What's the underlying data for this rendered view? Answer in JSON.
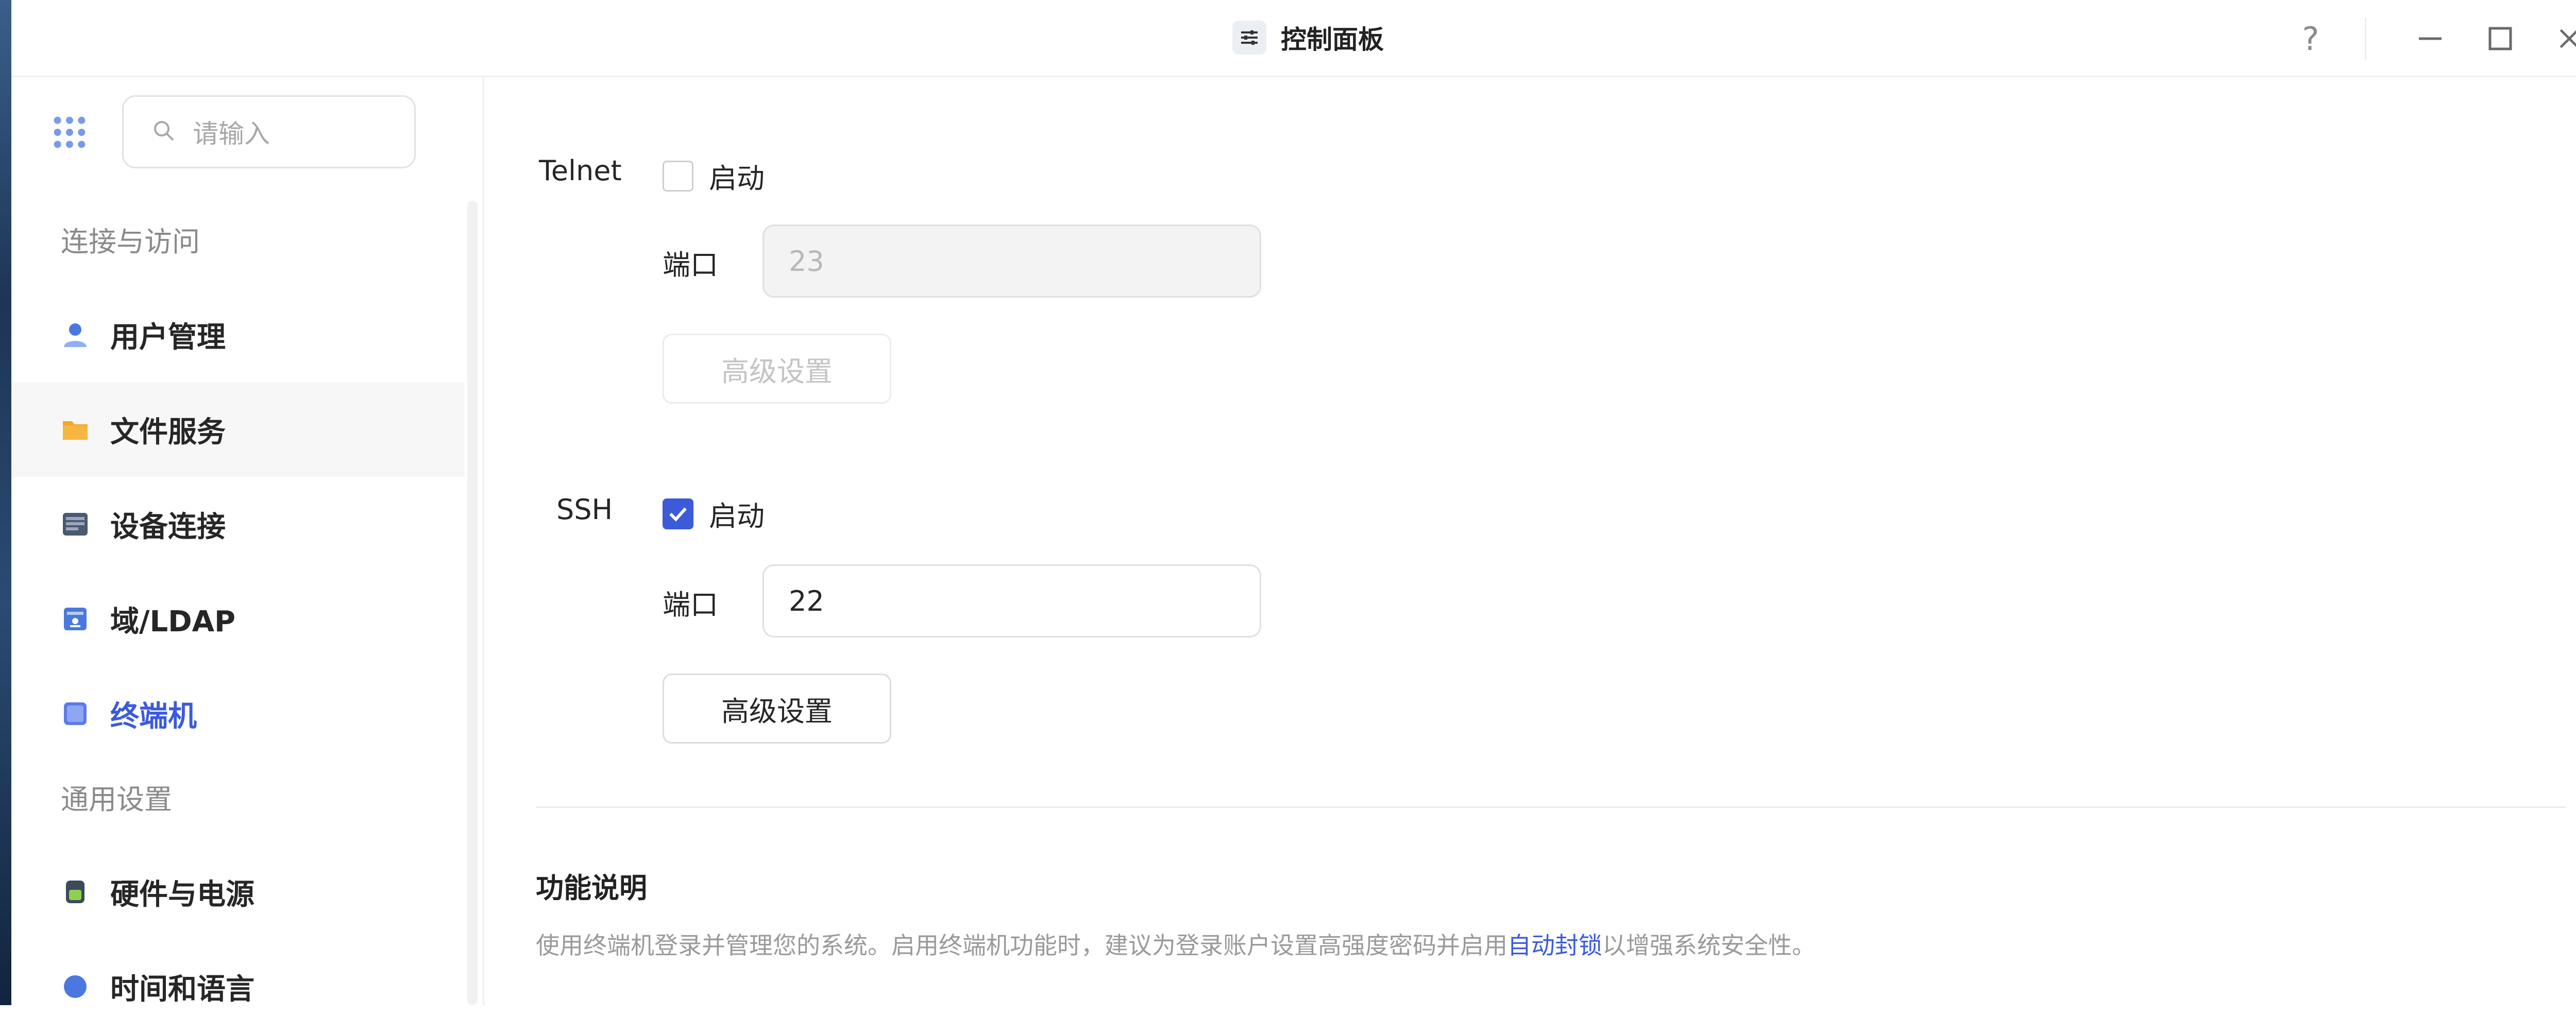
{
  "window": {
    "title": "控制面板",
    "title_icon": "sliders-icon",
    "controls": [
      "help-icon",
      "minimize-icon",
      "maximize-icon",
      "close-icon"
    ],
    "help_label": "?"
  },
  "sidebar": {
    "search_placeholder": "请输入",
    "sections": [
      {
        "title": "连接与访问",
        "items": [
          {
            "label": "用户管理",
            "icon": "user-icon"
          },
          {
            "label": "文件服务",
            "icon": "folder-icon"
          },
          {
            "label": "设备连接",
            "icon": "device-icon"
          },
          {
            "label": "域/LDAP",
            "icon": "domain-icon"
          },
          {
            "label": "终端机",
            "icon": "terminal-icon"
          }
        ]
      },
      {
        "title": "通用设置",
        "items": [
          {
            "label": "硬件与电源",
            "icon": "hardware-power-icon"
          },
          {
            "label": "时间和语言",
            "icon": "time-language-icon"
          }
        ]
      }
    ],
    "selected": "终端机",
    "hovered": "文件服务"
  },
  "main": {
    "telnet": {
      "label": "Telnet",
      "enable_label": "启动",
      "enabled": false,
      "port_label": "端口",
      "port_value": "23",
      "advanced_label": "高级设置"
    },
    "ssh": {
      "label": "SSH",
      "enable_label": "启动",
      "enabled": true,
      "port_label": "端口",
      "port_value": "22",
      "advanced_label": "高级设置"
    },
    "description": {
      "title": "功能说明",
      "text_before": "使用终端机登录并管理您的系统。启用终端机功能时，建议为登录账户设置高强度密码并启用",
      "link": "自动封锁",
      "text_after": "以增强系统安全性。"
    }
  },
  "colors": {
    "accent": "#3b5bdb",
    "folder": "#f5a623",
    "user": "#4a78e0"
  }
}
